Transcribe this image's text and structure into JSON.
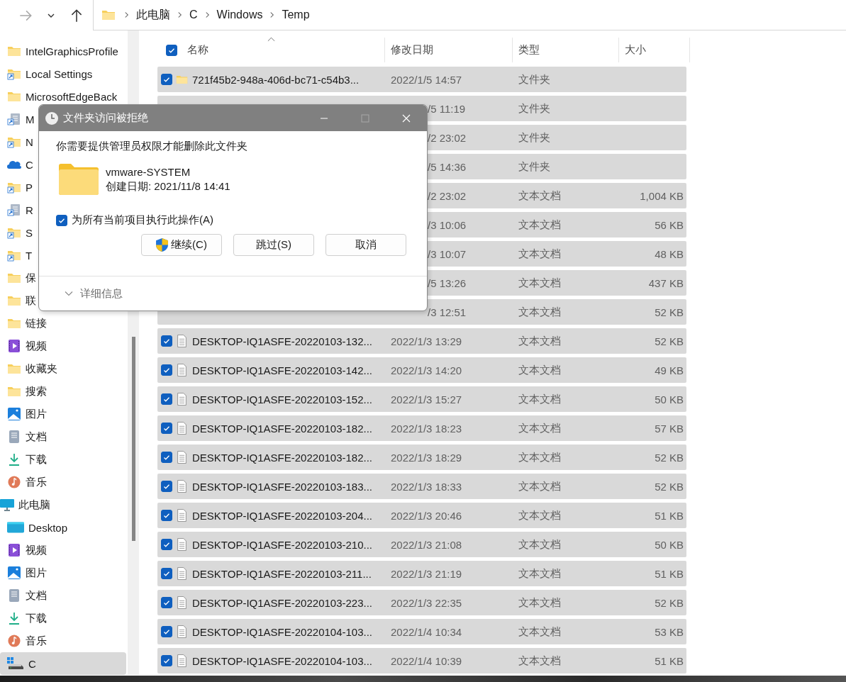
{
  "nav_buttons": [
    {
      "kind": "forward",
      "disabled": true
    },
    {
      "kind": "recent",
      "disabled": false
    },
    {
      "kind": "up",
      "disabled": false
    }
  ],
  "address_bar": {
    "breadcrumbs": [
      "此电脑",
      "C",
      "Windows",
      "Temp"
    ]
  },
  "sidebar": {
    "items": [
      {
        "label": "IntelGraphicsProfile",
        "kind": "folder",
        "selected": false
      },
      {
        "label": "Local Settings",
        "kind": "shortcut-folder",
        "selected": false
      },
      {
        "label": "MicrosoftEdgeBack",
        "kind": "folder",
        "selected": false
      },
      {
        "label": "M",
        "kind": "shortcut-doc",
        "selected": false
      },
      {
        "label": "N",
        "kind": "shortcut-folder",
        "selected": false
      },
      {
        "label": "C",
        "kind": "cloud",
        "selected": false
      },
      {
        "label": "P",
        "kind": "shortcut-folder",
        "selected": false
      },
      {
        "label": "R",
        "kind": "shortcut-doc",
        "selected": false
      },
      {
        "label": "S",
        "kind": "shortcut-folder",
        "selected": false
      },
      {
        "label": "T",
        "kind": "shortcut-folder",
        "selected": false
      },
      {
        "label": "保",
        "kind": "folder",
        "selected": false
      },
      {
        "label": "联",
        "kind": "folder",
        "selected": false
      },
      {
        "label": "链接",
        "kind": "folder",
        "selected": false
      },
      {
        "label": "视频",
        "kind": "video",
        "selected": false
      },
      {
        "label": "收藏夹",
        "kind": "folder",
        "selected": false
      },
      {
        "label": "搜索",
        "kind": "folder",
        "selected": false
      },
      {
        "label": "图片",
        "kind": "picture",
        "selected": false
      },
      {
        "label": "文档",
        "kind": "document",
        "selected": false
      },
      {
        "label": "下载",
        "kind": "download",
        "selected": false
      },
      {
        "label": "音乐",
        "kind": "music",
        "selected": false
      }
    ],
    "tree": {
      "label": "此电脑",
      "kind": "pc",
      "selected": false,
      "children": [
        {
          "label": "Desktop",
          "kind": "desktop",
          "selected": false
        },
        {
          "label": "视频",
          "kind": "video",
          "selected": false
        },
        {
          "label": "图片",
          "kind": "picture",
          "selected": false
        },
        {
          "label": "文档",
          "kind": "document",
          "selected": false
        },
        {
          "label": "下载",
          "kind": "download",
          "selected": false
        },
        {
          "label": "音乐",
          "kind": "music",
          "selected": false
        },
        {
          "label": "C",
          "kind": "drive",
          "selected": true
        }
      ]
    }
  },
  "table": {
    "select_all_checked": true,
    "columns": [
      {
        "label": "名称",
        "sorted": true
      },
      {
        "label": "修改日期",
        "sorted": false
      },
      {
        "label": "类型",
        "sorted": false
      },
      {
        "label": "大小",
        "sorted": false
      }
    ],
    "rows": [
      {
        "kind": "folder",
        "name": "721f45b2-948a-406d-bc71-c54b3...",
        "modified": "2022/1/5 14:57",
        "type": "文件夹",
        "selected": true
      },
      {
        "modified": "/5 11:19",
        "type": "文件夹",
        "selected": true
      },
      {
        "modified": "/2 23:02",
        "type": "文件夹",
        "selected": true
      },
      {
        "modified": "/5 14:36",
        "type": "文件夹",
        "selected": true
      },
      {
        "modified": "/2 23:02",
        "type": "文本文档",
        "size": "1,004 KB",
        "selected": true
      },
      {
        "modified": "/3 10:06",
        "type": "文本文档",
        "size": "56 KB",
        "selected": true
      },
      {
        "modified": "/3 10:07",
        "type": "文本文档",
        "size": "48 KB",
        "selected": true
      },
      {
        "modified": "/5 13:26",
        "type": "文本文档",
        "size": "437 KB",
        "selected": true
      },
      {
        "modified": "/3 12:51",
        "type": "文本文档",
        "size": "52 KB",
        "selected": true
      },
      {
        "kind": "text",
        "name": "DESKTOP-IQ1ASFE-20220103-132...",
        "modified": "2022/1/3 13:29",
        "type": "文本文档",
        "size": "52 KB",
        "selected": true
      },
      {
        "kind": "text",
        "name": "DESKTOP-IQ1ASFE-20220103-142...",
        "modified": "2022/1/3 14:20",
        "type": "文本文档",
        "size": "49 KB",
        "selected": true
      },
      {
        "kind": "text",
        "name": "DESKTOP-IQ1ASFE-20220103-152...",
        "modified": "2022/1/3 15:27",
        "type": "文本文档",
        "size": "50 KB",
        "selected": true
      },
      {
        "kind": "text",
        "name": "DESKTOP-IQ1ASFE-20220103-182...",
        "modified": "2022/1/3 18:23",
        "type": "文本文档",
        "size": "57 KB",
        "selected": true
      },
      {
        "kind": "text",
        "name": "DESKTOP-IQ1ASFE-20220103-182...",
        "modified": "2022/1/3 18:29",
        "type": "文本文档",
        "size": "52 KB",
        "selected": true
      },
      {
        "kind": "text",
        "name": "DESKTOP-IQ1ASFE-20220103-183...",
        "modified": "2022/1/3 18:33",
        "type": "文本文档",
        "size": "52 KB",
        "selected": true
      },
      {
        "kind": "text",
        "name": "DESKTOP-IQ1ASFE-20220103-204...",
        "modified": "2022/1/3 20:46",
        "type": "文本文档",
        "size": "51 KB",
        "selected": true
      },
      {
        "kind": "text",
        "name": "DESKTOP-IQ1ASFE-20220103-210...",
        "modified": "2022/1/3 21:08",
        "type": "文本文档",
        "size": "50 KB",
        "selected": true
      },
      {
        "kind": "text",
        "name": "DESKTOP-IQ1ASFE-20220103-211...",
        "modified": "2022/1/3 21:19",
        "type": "文本文档",
        "size": "51 KB",
        "selected": true
      },
      {
        "kind": "text",
        "name": "DESKTOP-IQ1ASFE-20220103-223...",
        "modified": "2022/1/3 22:35",
        "type": "文本文档",
        "size": "52 KB",
        "selected": true
      },
      {
        "kind": "text",
        "name": "DESKTOP-IQ1ASFE-20220104-103...",
        "modified": "2022/1/4 10:34",
        "type": "文本文档",
        "size": "53 KB",
        "selected": true
      },
      {
        "kind": "text",
        "name": "DESKTOP-IQ1ASFE-20220104-103...",
        "modified": "2022/1/4 10:39",
        "type": "文本文档",
        "size": "51 KB",
        "selected": true
      }
    ]
  },
  "dialog": {
    "title": "文件夹访问被拒绝",
    "message": "你需要提供管理员权限才能删除此文件夹",
    "item": {
      "name": "vmware-SYSTEM",
      "created": "创建日期: 2021/11/8 14:41"
    },
    "apply_all": {
      "label": "为所有当前项目执行此操作(A)",
      "checked": true
    },
    "buttons": [
      {
        "label": "继续(C)",
        "kind": "shield"
      },
      {
        "label": "跳过(S)",
        "kind": "plain"
      },
      {
        "label": "取消",
        "kind": "plain"
      }
    ],
    "details": {
      "label": "详细信息"
    }
  }
}
